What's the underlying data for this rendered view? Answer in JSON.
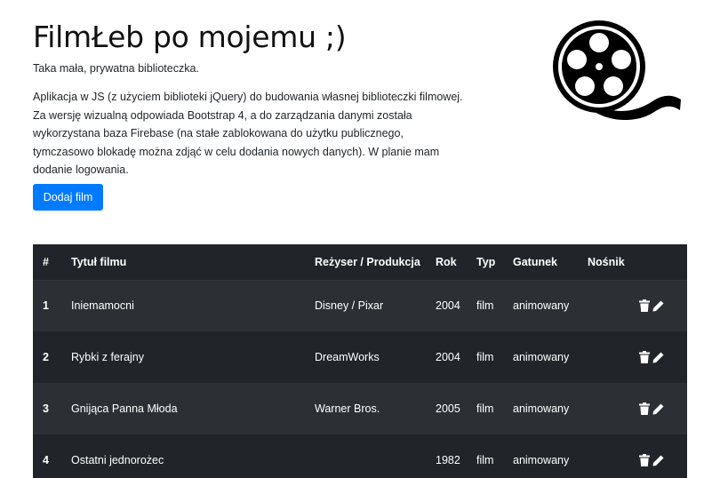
{
  "header": {
    "title": "FilmŁeb po mojemu ;)",
    "subtitle": "Taka mała, prywatna biblioteczka.",
    "description": "Aplikacja w JS (z użyciem biblioteki jQuery) do budowania własnej biblioteczki filmowej. Za wersję wizualną odpowiada Bootstrap 4, a do zarządzania danymi została wykorzystana baza Firebase (na stałe zablokowana do użytku publicznego, tymczasowo blokadę można zdjąć w celu dodania nowych danych). W planie mam dodanie logowania.",
    "add_button_label": "Dodaj film",
    "logo_icon": "film-reel-icon"
  },
  "table": {
    "headers": {
      "num": "#",
      "title": "Tytuł filmu",
      "director": "Reżyser / Produkcja",
      "year": "Rok",
      "type": "Typ",
      "genre": "Gatunek",
      "medium": "Nośnik",
      "actions": ""
    },
    "rows": [
      {
        "num": "1",
        "title": "Iniemamocni",
        "director": "Disney / Pixar",
        "year": "2004",
        "type": "film",
        "genre": "animowany",
        "medium": ""
      },
      {
        "num": "2",
        "title": "Rybki z ferajny",
        "director": "DreamWorks",
        "year": "2004",
        "type": "film",
        "genre": "animowany",
        "medium": ""
      },
      {
        "num": "3",
        "title": "Gnijąca Panna Młoda",
        "director": "Warner Bros.",
        "year": "2005",
        "type": "film",
        "genre": "animowany",
        "medium": ""
      },
      {
        "num": "4",
        "title": "Ostatni jednorożec",
        "director": "",
        "year": "1982",
        "type": "film",
        "genre": "animowany",
        "medium": ""
      }
    ],
    "action_icons": [
      "trash-icon",
      "pencil-icon"
    ]
  },
  "colors": {
    "primary": "#007bff",
    "table_dark": "#212529",
    "table_stripe": "#2c3035"
  }
}
